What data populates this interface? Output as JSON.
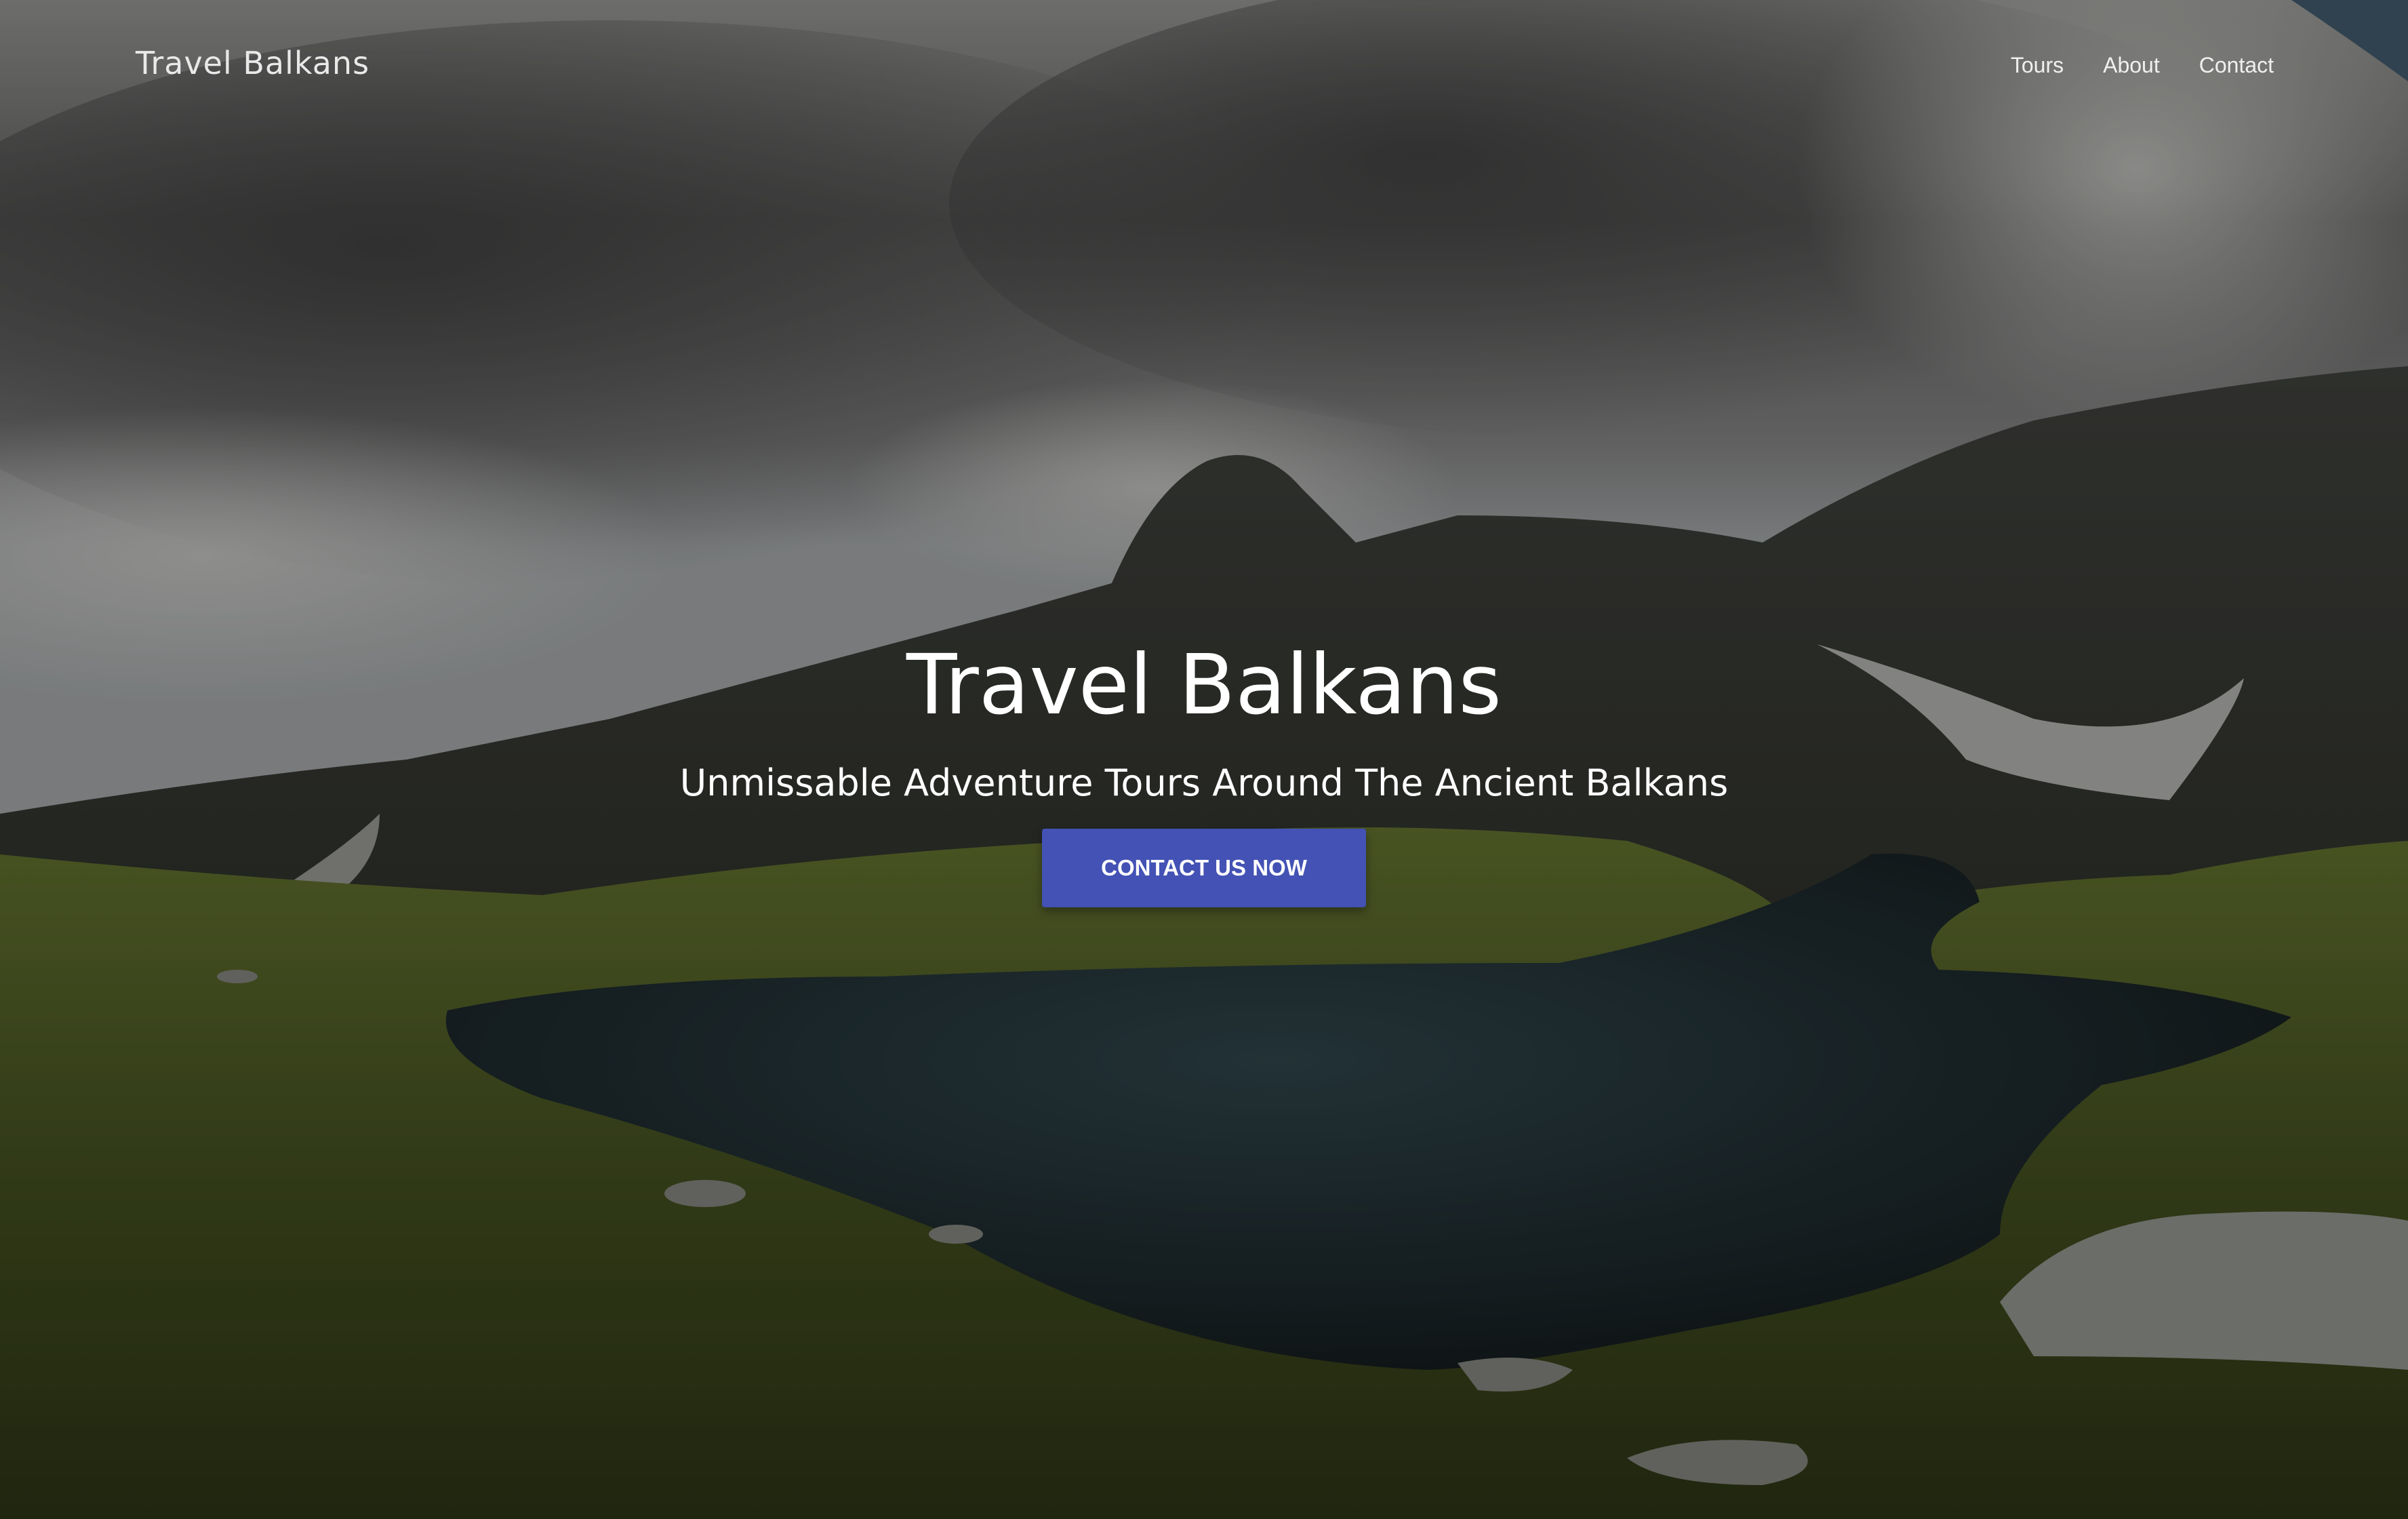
{
  "navbar": {
    "brand": "Travel Balkans",
    "links": [
      {
        "label": "Tours"
      },
      {
        "label": "About"
      },
      {
        "label": "Contact"
      }
    ]
  },
  "hero": {
    "title": "Travel Balkans",
    "subtitle": "Unmissable Adventure Tours Around The Ancient Balkans",
    "cta_label": "CONTACT US NOW",
    "background_image": "mountain-lake-landscape"
  },
  "colors": {
    "cta_background": "#4352b4",
    "text": "#ffffff"
  }
}
